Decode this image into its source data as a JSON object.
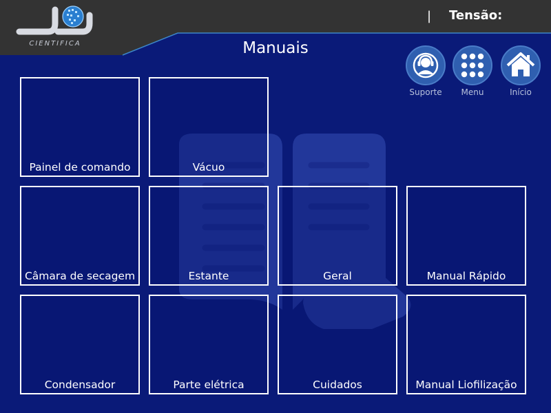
{
  "header": {
    "logo_text": "CIENTIFICA",
    "separator": "|",
    "voltage_label": "Tensão:"
  },
  "page": {
    "title": "Manuais"
  },
  "nav": {
    "support_label": "Suporte",
    "menu_label": "Menu",
    "home_label": "Início"
  },
  "tiles": [
    {
      "label": "Painel de comando"
    },
    {
      "label": "Vácuo"
    },
    {
      "label": "Câmara de secagem"
    },
    {
      "label": "Estante"
    },
    {
      "label": "Geral"
    },
    {
      "label": "Manual Rápido"
    },
    {
      "label": "Condensador"
    },
    {
      "label": "Parte elétrica"
    },
    {
      "label": "Cuidados"
    },
    {
      "label": "Manual Liofilização"
    }
  ],
  "colors": {
    "background": "#0a1a78",
    "header": "#333333",
    "accent_line": "#3d86c8",
    "nav_button": "#2f5fb0"
  }
}
